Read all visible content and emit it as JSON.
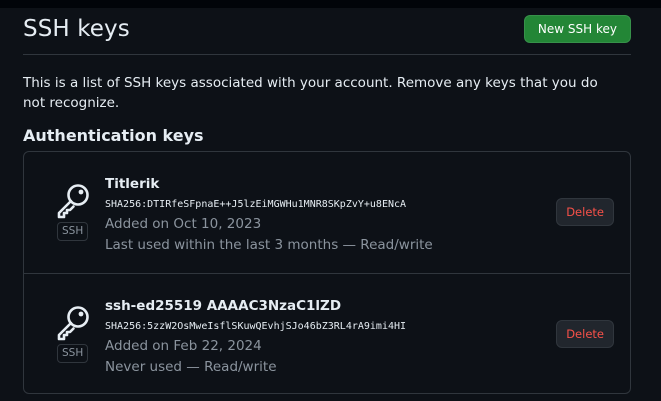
{
  "header": {
    "title": "SSH keys",
    "new_key_label": "New SSH key"
  },
  "description": "This is a list of SSH keys associated with your account. Remove any keys that you do not recognize.",
  "section_title": "Authentication keys",
  "keys": [
    {
      "name": "Titlerik",
      "fingerprint": "SHA256:DTIRfeSFpnaE++J5lzEiMGWHu1MNR8SKpZvY+u8ENcA",
      "added": "Added on Oct 10, 2023",
      "usage": "Last used within the last 3 months — Read/write",
      "badge": "SSH",
      "delete_label": "Delete"
    },
    {
      "name": "ssh-ed25519 AAAAC3NzaC1lZD",
      "fingerprint": "SHA256:5zzW2OsMweIsflSKuwQEvhjSJo46bZ3RL4rA9imi4HI",
      "added": "Added on Feb 22, 2024",
      "usage": "Never used — Read/write",
      "badge": "SSH",
      "delete_label": "Delete"
    }
  ],
  "colors": {
    "background": "#0d1117",
    "border": "#30363d",
    "primary_button": "#238636",
    "danger_text": "#f85149",
    "muted_text": "#8b949e"
  },
  "icons": {
    "key": "key-icon"
  }
}
